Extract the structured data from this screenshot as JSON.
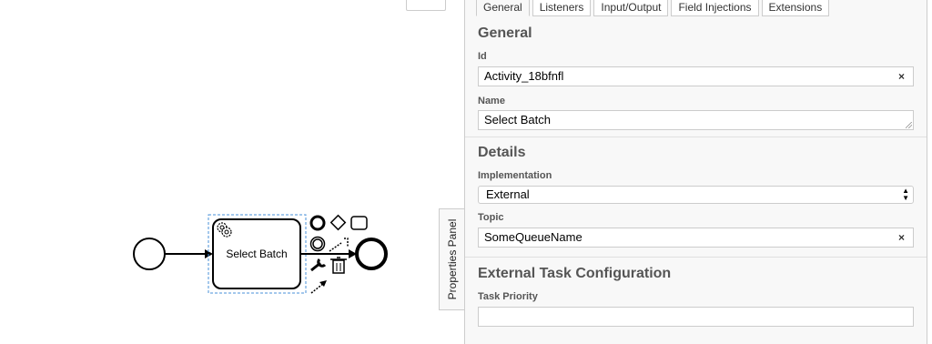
{
  "diagram": {
    "task_label": "Select Batch"
  },
  "toolbar": {
    "properties_panel_toggle": "Properties Panel"
  },
  "panel": {
    "tabs": [
      "General",
      "Listeners",
      "Input/Output",
      "Field Injections",
      "Extensions"
    ],
    "active_tab": "General",
    "general": {
      "title": "General",
      "id_label": "Id",
      "id_value": "Activity_18bfnfl",
      "name_label": "Name",
      "name_value": "Select Batch"
    },
    "details": {
      "title": "Details",
      "implementation_label": "Implementation",
      "implementation_value": "External",
      "topic_label": "Topic",
      "topic_value": "SomeQueueName"
    },
    "external": {
      "title": "External Task Configuration",
      "priority_label": "Task Priority",
      "priority_value": ""
    },
    "clear_glyph": "×"
  },
  "icons": [
    "gear-icon",
    "trash-icon",
    "wrench-icon",
    "arrow-icon",
    "chevron-icon",
    "select-arrows-icon"
  ]
}
